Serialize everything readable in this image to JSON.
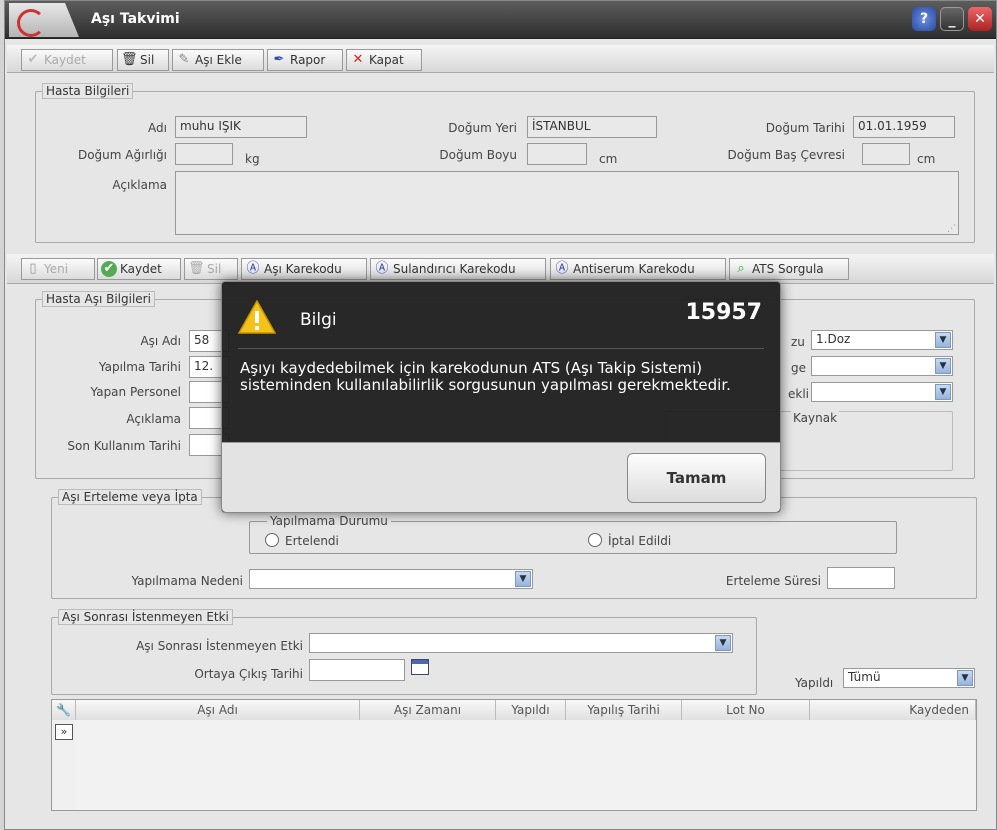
{
  "window": {
    "title": "Aşı Takvimi"
  },
  "toolbar1": {
    "kaydet": "Kaydet",
    "sil": "Sil",
    "asi_ekle": "Aşı Ekle",
    "rapor": "Rapor",
    "kapat": "Kapat"
  },
  "hasta": {
    "legend": "Hasta Bilgileri",
    "adi_label": "Adı",
    "adi_value": "muhu IŞIK",
    "dogum_yeri_label": "Doğum Yeri",
    "dogum_yeri_value": "İSTANBUL",
    "dogum_tarihi_label": "Doğum Tarihi",
    "dogum_tarihi_value": "01.01.1959",
    "dogum_agirligi_label": "Doğum Ağırlığı",
    "kg": "kg",
    "dogum_boyu_label": "Doğum Boyu",
    "cm1": "cm",
    "bas_cevresi_label": "Doğum Baş Çevresi",
    "cm2": "cm",
    "aciklama_label": "Açıklama"
  },
  "toolbar2": {
    "yeni": "Yeni",
    "kaydet": "Kaydet",
    "sil": "Sil",
    "asi_karekodu": "Aşı Karekodu",
    "sulandirici": "Sulandırıcı Karekodu",
    "antiserum": "Antiserum Karekodu",
    "ats": "ATS Sorgula"
  },
  "asi": {
    "legend": "Hasta Aşı Bilgileri",
    "asi_adi_label": "Aşı Adı",
    "asi_adi_value": "58",
    "yapilma_tarihi_label": "Yapılma Tarihi",
    "yapilma_tarihi_value": "12.",
    "yapan_personel_label": "Yapan Personel",
    "aciklama_label": "Açıklama",
    "son_kullanim_label": "Son Kullanım Tarihi",
    "doz_label": "zu",
    "doz_value": "1.Doz",
    "bolge_label": "ge",
    "sekli_label": "ekli",
    "kaynak_label": "Kaynak"
  },
  "erteleme": {
    "legend": "Aşı Erteleme veya İpta",
    "durum_legend": "Yapılmama Durumu",
    "ertelendi": "Ertelendi",
    "iptal": "İptal Edildi",
    "neden_label": "Yapılmama Nedeni",
    "sure_label": "Erteleme Süresi"
  },
  "etki": {
    "legend": "Aşı Sonrası İstenmeyen Etki",
    "etki_label": "Aşı Sonrası İstenmeyen Etki",
    "cikis_label": "Ortaya Çıkış Tarihi"
  },
  "filter": {
    "yapildi_label": "Yapıldı",
    "yapildi_value": "Tümü"
  },
  "grid": {
    "columns": [
      "Aşı Adı",
      "Aşı Zamanı",
      "Yapıldı",
      "Yapılış Tarihi",
      "Lot No",
      "Kaydeden"
    ],
    "expander": "»"
  },
  "dialog": {
    "title": "Bilgi",
    "code": "15957",
    "message": "Aşıyı kaydedebilmek için karekodunun ATS (Aşı Takip Sistemi) sisteminden kullanılabilirlik sorgusunun yapılması gerekmektedir.",
    "ok": "Tamam"
  },
  "colors": {
    "titlebar": "#3a3a3a",
    "dialog_bg": "#1e1e1e",
    "accent_blue": "#97b3dc"
  }
}
